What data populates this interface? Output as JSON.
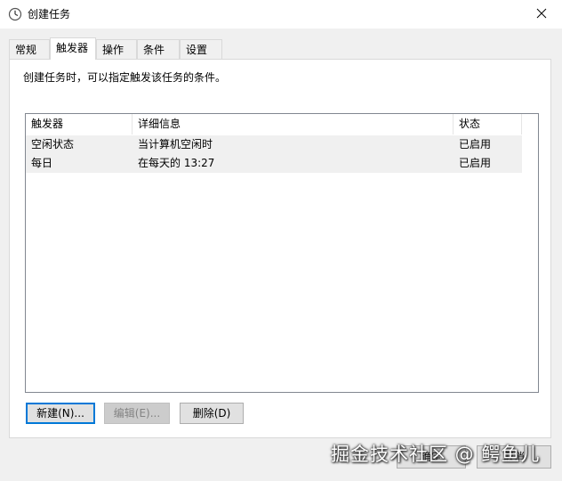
{
  "window": {
    "title": "创建任务"
  },
  "tabs": [
    {
      "label": "常规"
    },
    {
      "label": "触发器"
    },
    {
      "label": "操作"
    },
    {
      "label": "条件"
    },
    {
      "label": "设置"
    }
  ],
  "description": "创建任务时，可以指定触发该任务的条件。",
  "table": {
    "columns": [
      "触发器",
      "详细信息",
      "状态"
    ],
    "rows": [
      [
        "空闲状态",
        "当计算机空闲时",
        "已启用"
      ],
      [
        "每日",
        "在每天的 13:27",
        "已启用"
      ]
    ]
  },
  "buttons": {
    "new": "新建(N)...",
    "edit": "编辑(E)...",
    "delete": "删除(D)"
  },
  "footer": {
    "ok": "确定",
    "cancel": "取消"
  },
  "watermark": "掘金技术社区 @ 鳄鱼儿",
  "colors": {
    "accent": "#0078d7",
    "row_bg": "#f0f0f0",
    "window_bg": "#f0f0f0"
  }
}
